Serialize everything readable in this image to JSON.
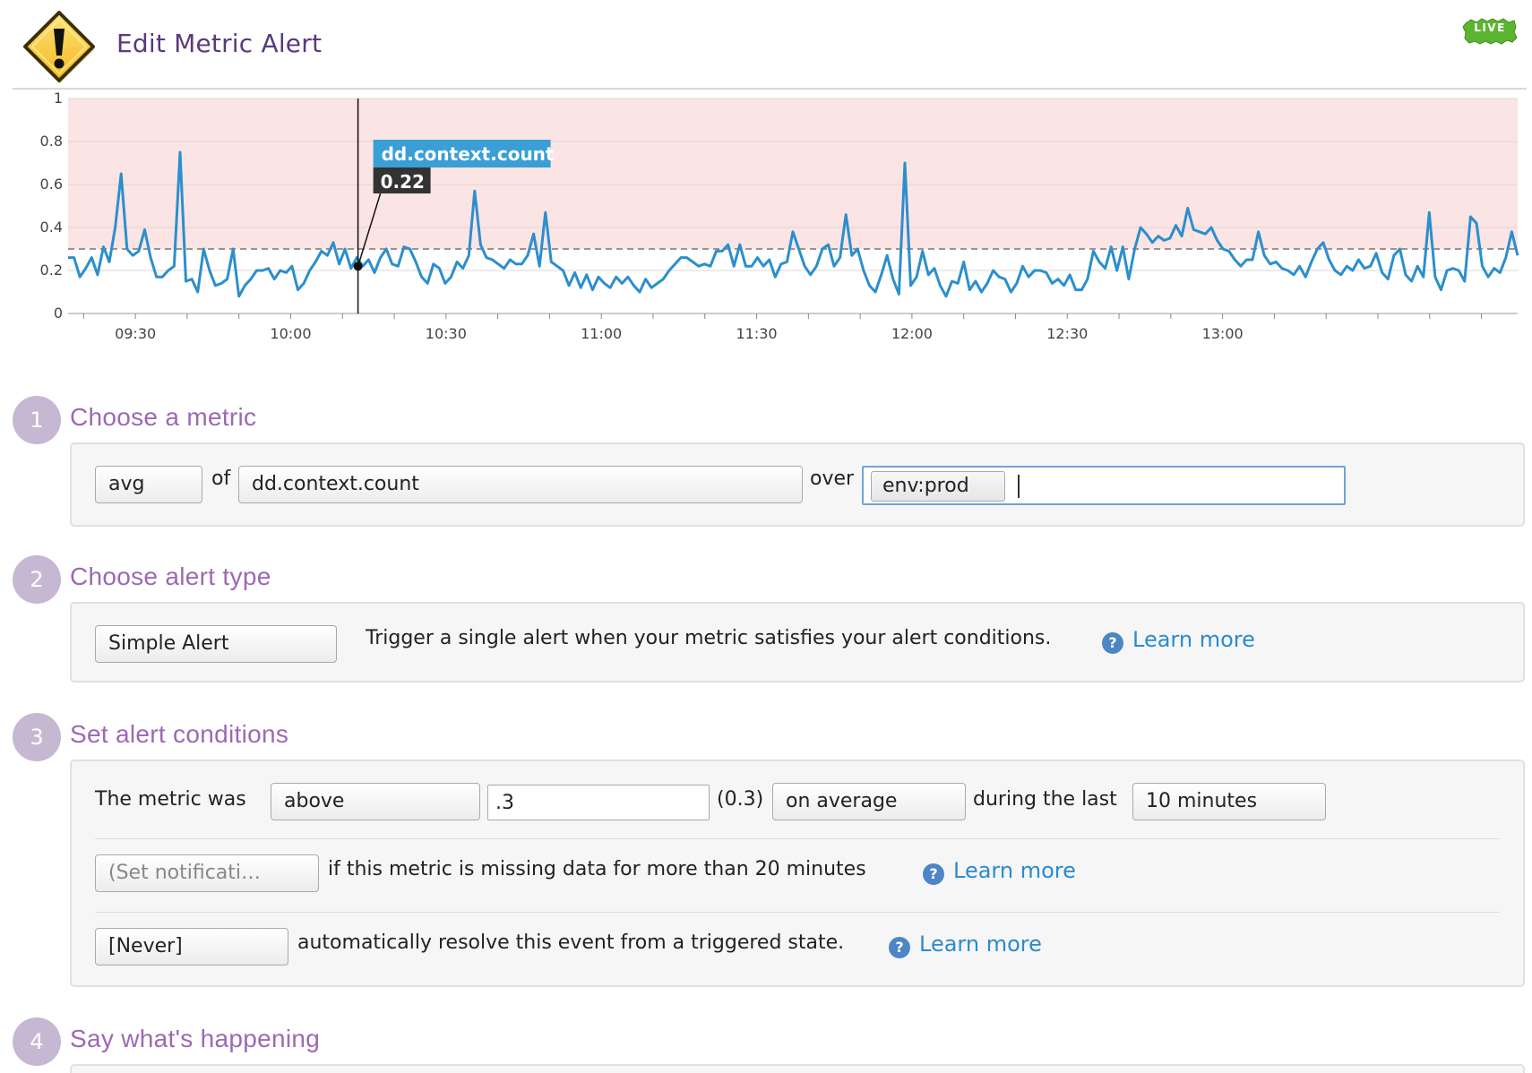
{
  "page": {
    "title": "Edit Metric Alert",
    "live_badge": "LIVE"
  },
  "chart_data": {
    "type": "line",
    "title": "",
    "xlabel": "",
    "ylabel": "",
    "ylim": [
      0,
      1
    ],
    "y_ticks": [
      "0",
      "0.2",
      "0.4",
      "0.6",
      "0.8",
      "1"
    ],
    "x_tick_labels": [
      "09:30",
      "10:00",
      "10:30",
      "11:00",
      "11:30",
      "12:00",
      "12:30",
      "13:00"
    ],
    "x_start": "09:17",
    "x_end": "13:57",
    "threshold": 0.3,
    "alert_region": "above 0.3",
    "grid": true,
    "series": [
      {
        "name": "dd.context.count",
        "color": "#2b8fcc",
        "values": [
          0.26,
          0.26,
          0.17,
          0.21,
          0.26,
          0.18,
          0.31,
          0.24,
          0.4,
          0.65,
          0.3,
          0.27,
          0.29,
          0.39,
          0.26,
          0.17,
          0.17,
          0.2,
          0.22,
          0.75,
          0.15,
          0.16,
          0.1,
          0.3,
          0.2,
          0.13,
          0.14,
          0.16,
          0.3,
          0.08,
          0.13,
          0.16,
          0.2,
          0.2,
          0.21,
          0.16,
          0.2,
          0.19,
          0.22,
          0.11,
          0.14,
          0.2,
          0.24,
          0.29,
          0.27,
          0.33,
          0.23,
          0.3,
          0.21,
          0.26,
          0.22,
          0.25,
          0.19,
          0.26,
          0.3,
          0.23,
          0.22,
          0.31,
          0.3,
          0.24,
          0.17,
          0.14,
          0.23,
          0.21,
          0.14,
          0.17,
          0.24,
          0.21,
          0.27,
          0.57,
          0.32,
          0.26,
          0.25,
          0.23,
          0.21,
          0.25,
          0.23,
          0.23,
          0.27,
          0.37,
          0.22,
          0.47,
          0.24,
          0.22,
          0.2,
          0.13,
          0.19,
          0.12,
          0.18,
          0.11,
          0.17,
          0.14,
          0.12,
          0.17,
          0.14,
          0.17,
          0.13,
          0.1,
          0.16,
          0.12,
          0.14,
          0.16,
          0.2,
          0.23,
          0.26,
          0.26,
          0.24,
          0.22,
          0.23,
          0.22,
          0.29,
          0.29,
          0.32,
          0.22,
          0.32,
          0.22,
          0.22,
          0.26,
          0.22,
          0.25,
          0.17,
          0.23,
          0.24,
          0.38,
          0.3,
          0.22,
          0.18,
          0.22,
          0.3,
          0.32,
          0.22,
          0.26,
          0.46,
          0.27,
          0.3,
          0.2,
          0.13,
          0.1,
          0.18,
          0.27,
          0.16,
          0.09,
          0.7,
          0.13,
          0.17,
          0.29,
          0.18,
          0.21,
          0.13,
          0.08,
          0.15,
          0.14,
          0.24,
          0.11,
          0.15,
          0.1,
          0.14,
          0.2,
          0.17,
          0.16,
          0.1,
          0.14,
          0.22,
          0.17,
          0.2,
          0.2,
          0.19,
          0.14,
          0.16,
          0.13,
          0.18,
          0.11,
          0.11,
          0.16,
          0.29,
          0.24,
          0.21,
          0.31,
          0.2,
          0.31,
          0.16,
          0.3,
          0.4,
          0.37,
          0.33,
          0.36,
          0.34,
          0.35,
          0.41,
          0.36,
          0.49,
          0.39,
          0.38,
          0.37,
          0.4,
          0.34,
          0.3,
          0.29,
          0.25,
          0.22,
          0.25,
          0.25,
          0.38,
          0.27,
          0.23,
          0.24,
          0.21,
          0.2,
          0.18,
          0.22,
          0.17,
          0.24,
          0.3,
          0.33,
          0.25,
          0.2,
          0.18,
          0.22,
          0.2,
          0.25,
          0.21,
          0.22,
          0.28,
          0.19,
          0.16,
          0.27,
          0.3,
          0.18,
          0.15,
          0.22,
          0.17,
          0.47,
          0.17,
          0.11,
          0.2,
          0.21,
          0.2,
          0.15,
          0.45,
          0.42,
          0.22,
          0.17,
          0.21,
          0.19,
          0.26,
          0.38,
          0.27
        ]
      }
    ],
    "hover": {
      "time": "10:13",
      "label": "dd.context.count",
      "value": "0.22"
    }
  },
  "steps": [
    {
      "number": "1",
      "title": "Choose a metric"
    },
    {
      "number": "2",
      "title": "Choose alert type"
    },
    {
      "number": "3",
      "title": "Set alert conditions"
    },
    {
      "number": "4",
      "title": "Say what's happening"
    }
  ],
  "metric": {
    "aggregation": "avg",
    "of_label": "of",
    "metric_name": "dd.context.count",
    "over_label": "over",
    "tag": "env:prod"
  },
  "alert_type": {
    "selected": "Simple Alert",
    "description": "Trigger a single alert when your metric satisfies your alert conditions.",
    "learn_more": "Learn more",
    "help_icon": "question-circle-icon"
  },
  "conditions": {
    "prefix": "The metric was",
    "comparator": "above",
    "threshold_input": ".3",
    "threshold_display": "(0.3)",
    "aggregation": "on average",
    "window_label": "during the last",
    "window": "10 minutes",
    "no_data_placeholder": "(Set notificati…",
    "no_data_text": "if this metric is missing data for more than 20 minutes",
    "no_data_learn_more": "Learn more",
    "resolve_value": "[Never]",
    "resolve_text": "automatically resolve this event from a triggered state.",
    "resolve_learn_more": "Learn more"
  },
  "colors": {
    "title": "#5a3a7a",
    "step_title": "#9b69b5",
    "step_circle": "#c6b8d2",
    "link": "#2a8ad0",
    "alert_region": "#fbe4e4",
    "series": "#2b8fcc",
    "live_badge": "#5cb531"
  }
}
